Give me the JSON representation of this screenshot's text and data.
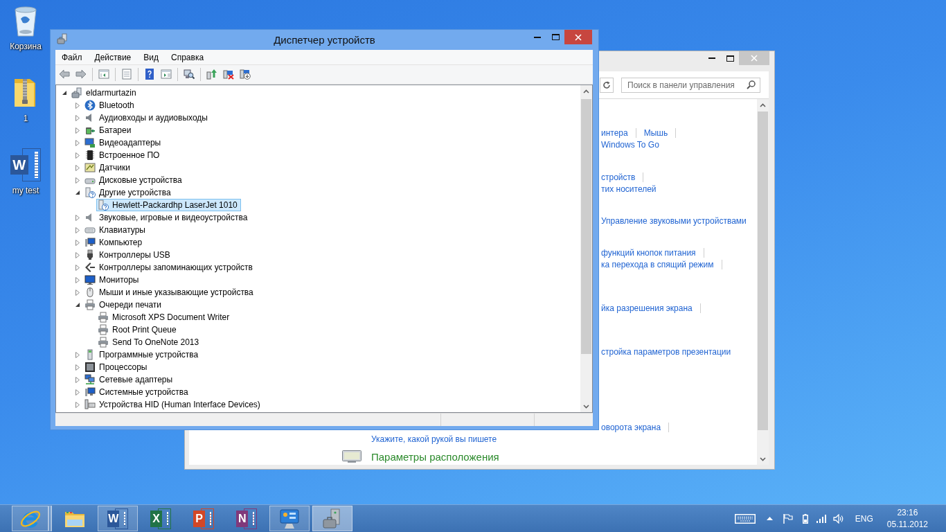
{
  "desktop_icons": [
    {
      "kind": "recycle-bin",
      "label": "Корзина"
    },
    {
      "kind": "zip-folder",
      "label": "1"
    },
    {
      "kind": "word-document",
      "glyph": "W",
      "label": "my test"
    }
  ],
  "control_panel": {
    "search": {
      "placeholder": "Поиск в панели управления"
    },
    "sections": [
      {
        "lines": [
          {
            "kind": "partial",
            "links": [
              {
                "text": "интера",
                "separator": true
              },
              {
                "text": "Мышь",
                "separator": true
              }
            ]
          },
          {
            "kind": "partial",
            "links": [
              {
                "text": "Windows To Go",
                "separator": false
              }
            ]
          }
        ]
      },
      {
        "lines": [
          {
            "kind": "partial",
            "links": [
              {
                "text": "стройств",
                "separator": true
              }
            ]
          },
          {
            "kind": "partial",
            "links": [
              {
                "text": "тих носителей",
                "separator": false
              }
            ]
          }
        ]
      },
      {
        "lines": [
          {
            "kind": "partial",
            "links": [
              {
                "text": "Управление звуковыми устройствами",
                "separator": false
              }
            ]
          }
        ]
      },
      {
        "lines": [
          {
            "kind": "partial",
            "links": [
              {
                "text": "функций кнопок питания",
                "separator": true
              }
            ]
          },
          {
            "kind": "partial",
            "links": [
              {
                "text": "ка перехода в спящий режим",
                "separator": true
              }
            ]
          }
        ]
      },
      {
        "lines": [
          {
            "kind": "partial",
            "links": [
              {
                "text": "йка разрешения экрана",
                "separator": true
              }
            ]
          }
        ]
      },
      {
        "lines": [
          {
            "kind": "partial",
            "links": [
              {
                "text": "стройка параметров презентации",
                "separator": false
              }
            ]
          }
        ]
      },
      {
        "lines": [
          {
            "kind": "partial",
            "links": [
              {
                "text": "оворота экрана",
                "separator": true
              }
            ]
          },
          {
            "kind": "full",
            "links": [
              {
                "text": "Укажите, какой рукой вы пишете",
                "separator": false
              }
            ]
          }
        ]
      },
      {
        "heading": "Параметры расположения"
      }
    ]
  },
  "device_manager": {
    "title": "Диспетчер устройств",
    "menu": [
      "Файл",
      "Действие",
      "Вид",
      "Справка"
    ],
    "toolbar": [
      {
        "kind": "back"
      },
      {
        "kind": "forward"
      },
      {
        "kind": "separator"
      },
      {
        "kind": "console-tree"
      },
      {
        "kind": "separator"
      },
      {
        "kind": "properties"
      },
      {
        "kind": "separator"
      },
      {
        "kind": "help"
      },
      {
        "kind": "action-pane"
      },
      {
        "kind": "separator"
      },
      {
        "kind": "scan"
      },
      {
        "kind": "separator"
      },
      {
        "kind": "update"
      },
      {
        "kind": "uninstall"
      },
      {
        "kind": "disable"
      }
    ],
    "tree": [
      {
        "kind": "computer",
        "label": "eldarmurtazin",
        "expanded": true,
        "selected": false,
        "children": [
          {
            "kind": "bluetooth",
            "label": "Bluetooth",
            "expanded": false,
            "selected": false
          },
          {
            "kind": "audio",
            "label": "Аудиовходы и аудиовыходы",
            "expanded": false,
            "selected": false
          },
          {
            "kind": "battery",
            "label": "Батареи",
            "expanded": false,
            "selected": false
          },
          {
            "kind": "display",
            "label": "Видеоадаптеры",
            "expanded": false,
            "selected": false
          },
          {
            "kind": "firmware",
            "label": "Встроенное ПО",
            "expanded": false,
            "selected": false
          },
          {
            "kind": "sensor",
            "label": "Датчики",
            "expanded": false,
            "selected": false
          },
          {
            "kind": "disk",
            "label": "Дисковые устройства",
            "expanded": false,
            "selected": false
          },
          {
            "kind": "unknown",
            "label": "Другие устройства",
            "expanded": true,
            "selected": false,
            "children": [
              {
                "kind": "unknown",
                "label": "Hewlett-Packardhp LaserJet 1010",
                "selected": true
              }
            ]
          },
          {
            "kind": "sound",
            "label": "Звуковые, игровые и видеоустройства",
            "expanded": false,
            "selected": false
          },
          {
            "kind": "keyboard",
            "label": "Клавиатуры",
            "expanded": false,
            "selected": false
          },
          {
            "kind": "computer-unit",
            "label": "Компьютер",
            "expanded": false,
            "selected": false
          },
          {
            "kind": "usb",
            "label": "Контроллеры USB",
            "expanded": false,
            "selected": false
          },
          {
            "kind": "storage",
            "label": "Контроллеры запоминающих устройств",
            "expanded": false,
            "selected": false
          },
          {
            "kind": "monitor",
            "label": "Мониторы",
            "expanded": false,
            "selected": false
          },
          {
            "kind": "mouse",
            "label": "Мыши и иные указывающие устройства",
            "expanded": false,
            "selected": false
          },
          {
            "kind": "printer",
            "label": "Очереди печати",
            "expanded": true,
            "selected": false,
            "children": [
              {
                "kind": "printer",
                "label": "Microsoft XPS Document Writer",
                "selected": false
              },
              {
                "kind": "printer",
                "label": "Root Print Queue",
                "selected": false
              },
              {
                "kind": "printer",
                "label": "Send To OneNote 2013",
                "selected": false
              }
            ]
          },
          {
            "kind": "software",
            "label": "Программные устройства",
            "expanded": false,
            "selected": false
          },
          {
            "kind": "processor",
            "label": "Процессоры",
            "expanded": false,
            "selected": false
          },
          {
            "kind": "network",
            "label": "Сетевые адаптеры",
            "expanded": false,
            "selected": false
          },
          {
            "kind": "system",
            "label": "Системные устройства",
            "expanded": false,
            "selected": false
          },
          {
            "kind": "hid",
            "label": "Устройства HID (Human Interface Devices)",
            "expanded": false,
            "selected": false
          }
        ]
      }
    ]
  },
  "taskbar": {
    "items": [
      {
        "kind": "browser",
        "running": true,
        "stacked": true,
        "selected": false
      },
      {
        "kind": "folder",
        "running": false,
        "stacked": false,
        "selected": false
      },
      {
        "kind": "word",
        "glyph": "W",
        "running": true,
        "stacked": false,
        "selected": false
      },
      {
        "kind": "excel",
        "glyph": "X",
        "running": false,
        "stacked": false,
        "selected": false
      },
      {
        "kind": "powerpoint",
        "glyph": "P",
        "running": false,
        "stacked": false,
        "selected": false
      },
      {
        "kind": "onenote",
        "glyph": "N",
        "running": false,
        "stacked": false,
        "selected": false
      },
      {
        "kind": "control-panel",
        "running": true,
        "stacked": false,
        "selected": false
      },
      {
        "kind": "device-manager",
        "running": true,
        "stacked": false,
        "selected": true
      }
    ],
    "tray": {
      "language": "ENG",
      "time": "23:16",
      "date": "05.11.2012"
    }
  }
}
